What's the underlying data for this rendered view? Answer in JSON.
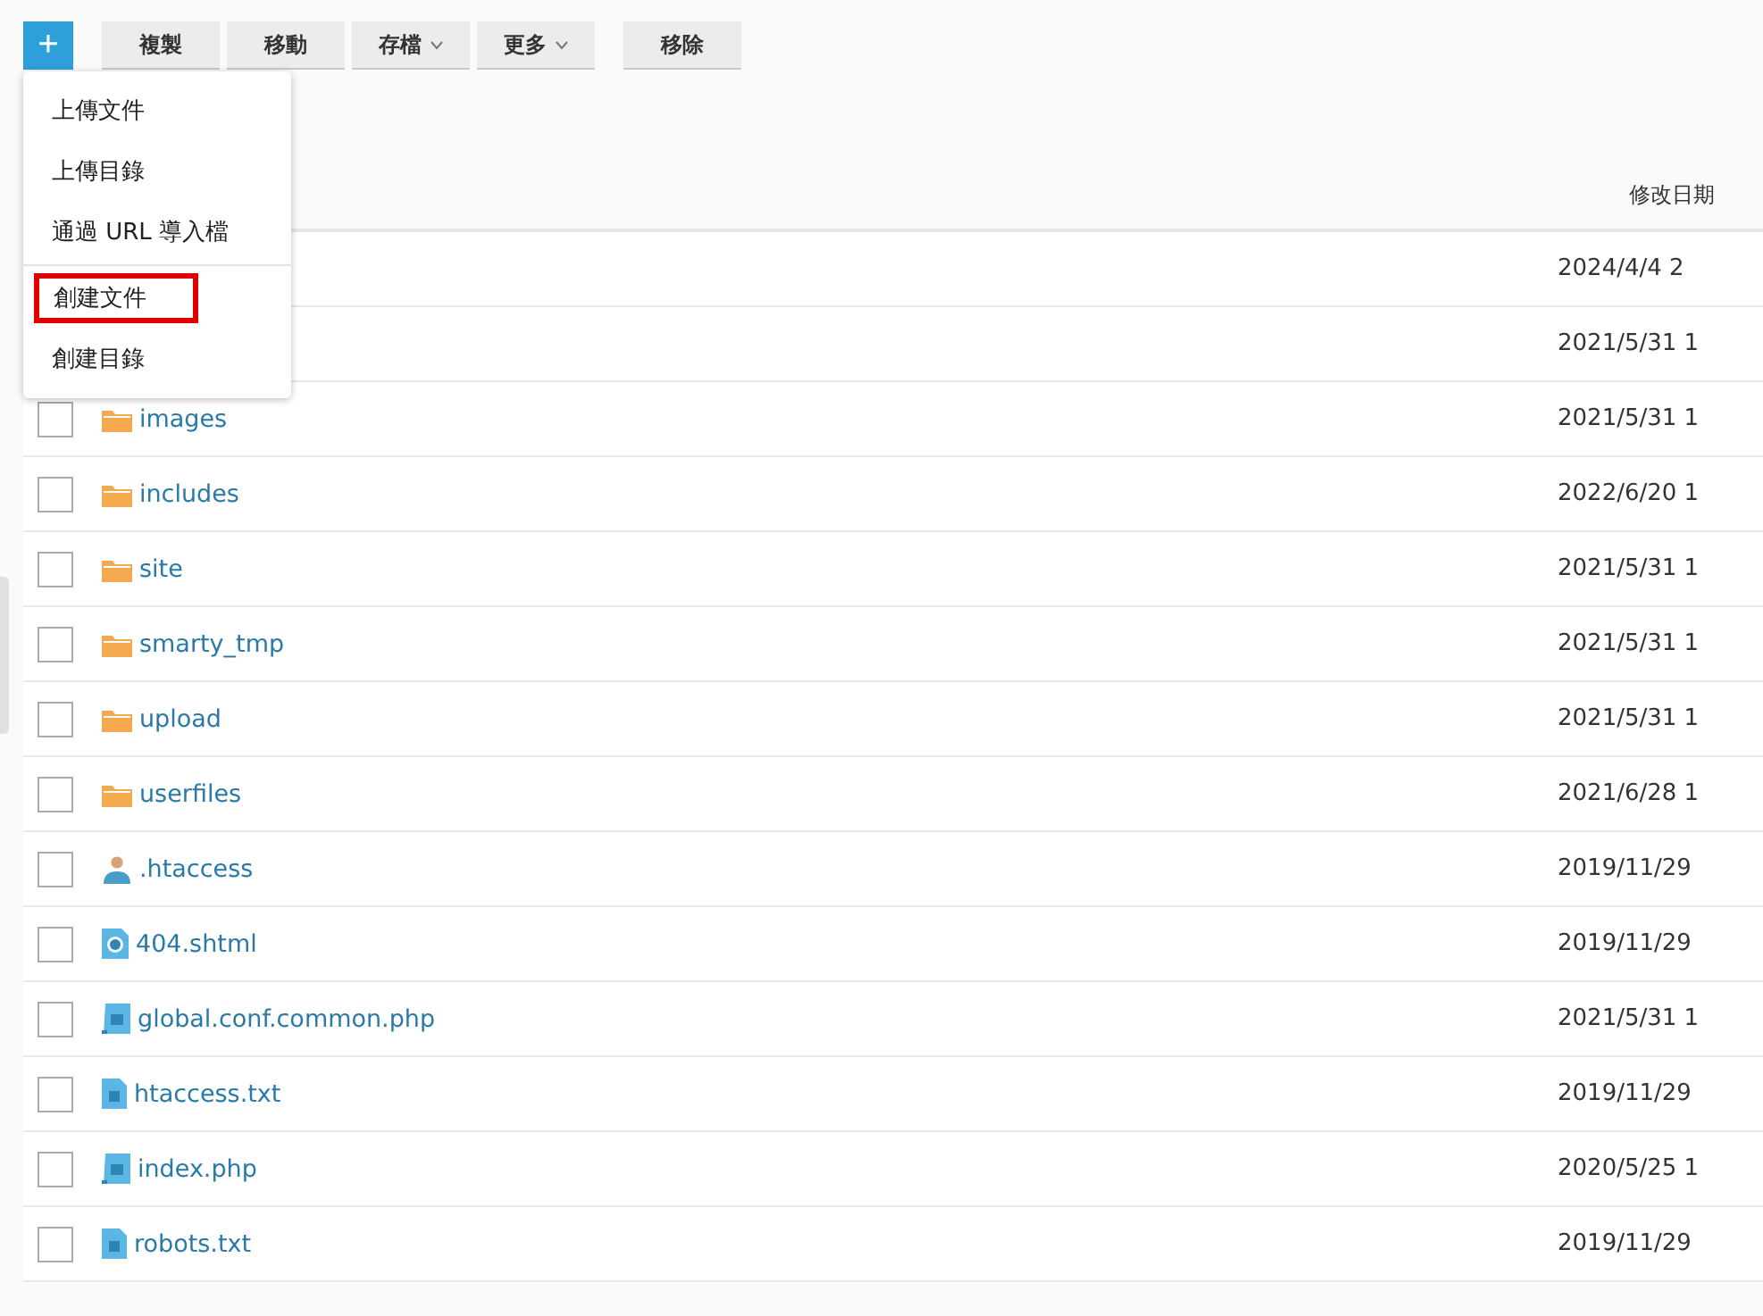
{
  "toolbar": {
    "add_button": "+",
    "buttons": [
      {
        "label": "複製",
        "dropdown": false
      },
      {
        "label": "移動",
        "dropdown": false
      },
      {
        "label": "存檔",
        "dropdown": true
      },
      {
        "label": "更多",
        "dropdown": true
      },
      {
        "label": "移除",
        "dropdown": false
      }
    ]
  },
  "add_menu": {
    "groups": [
      [
        {
          "label": "上傳文件",
          "highlighted": false
        },
        {
          "label": "上傳目錄",
          "highlighted": false
        },
        {
          "label": "通過 URL 導入檔",
          "highlighted": false
        }
      ],
      [
        {
          "label": "創建文件",
          "highlighted": true
        },
        {
          "label": "創建目錄",
          "highlighted": false
        }
      ]
    ]
  },
  "table": {
    "columns": {
      "modified": "修改日期"
    },
    "rows": [
      {
        "date": "2024/4/4 2"
      },
      {
        "date": "2021/5/31 1"
      },
      {
        "kind": "folder",
        "name": "images",
        "date": "2021/5/31 1",
        "checked": false
      },
      {
        "kind": "folder",
        "name": "includes",
        "date": "2022/6/20 1",
        "checked": false
      },
      {
        "kind": "folder",
        "name": "site",
        "date": "2021/5/31 1",
        "checked": false
      },
      {
        "kind": "folder",
        "name": "smarty_tmp",
        "date": "2021/5/31 1",
        "checked": false
      },
      {
        "kind": "folder",
        "name": "upload",
        "date": "2021/5/31 1",
        "checked": false
      },
      {
        "kind": "folder",
        "name": "userfiles",
        "date": "2021/6/28 1",
        "checked": false
      },
      {
        "kind": "user",
        "name": ".htaccess",
        "date": "2019/11/29",
        "checked": false
      },
      {
        "kind": "web",
        "name": "404.shtml",
        "date": "2019/11/29",
        "checked": false
      },
      {
        "kind": "script",
        "name": "global.conf.common.php",
        "date": "2021/5/31 1",
        "checked": false
      },
      {
        "kind": "text",
        "name": "htaccess.txt",
        "date": "2019/11/29",
        "checked": false
      },
      {
        "kind": "script",
        "name": "index.php",
        "date": "2020/5/25 1",
        "checked": false
      },
      {
        "kind": "text",
        "name": "robots.txt",
        "date": "2019/11/29",
        "checked": false
      }
    ]
  }
}
